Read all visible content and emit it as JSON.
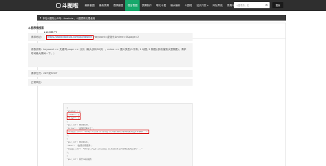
{
  "header": {
    "logo_text": "斗图啦",
    "nav": [
      {
        "label": "最新套图",
        "active": false
      },
      {
        "label": "最新表情",
        "active": false
      },
      {
        "label": "表情套图",
        "active": false
      },
      {
        "label": "恒言表图",
        "active": true
      },
      {
        "label": "表情制作",
        "active": false
      },
      {
        "label": "聊天斗图",
        "active": false
      },
      {
        "label": "输水偏码",
        "active": false
      },
      {
        "label": "斗图啦",
        "active": false
      },
      {
        "label": "站长开发 ▾",
        "active": false
      },
      {
        "label": "网站导航",
        "active": false
      },
      {
        "label": "表情斗图",
        "active": false
      }
    ],
    "search_placeholder": "斗图表情，在",
    "search_button": "搜索"
  },
  "breadcrumb": "本站斗图啦公众号：ibnshuls ，斗图表情无限使用",
  "card": {
    "title": "API接口",
    "section_title": "斗图表情搜索",
    "request_label": "请求地址：",
    "request_url": "https://www.doutula.com/api/search",
    "request_url_rest": "?keyword=金馆长&mime=0&page=2",
    "params": "参数说明：keyword => 关键词 page => 分页（最大页码50页），mime => 图片类型(0 所有, 1 动图, 2 静图)(其他值默认是静图)；请求时间最大隔间一下。)",
    "method": "请求方式：GET或POST",
    "response_label": "正常响应："
  },
  "code_lines": [
    "{",
    "    \"status\": 1,",
    "    \"data\": {",
    "        \"list\": [",
    "            {",
    "                \"pic_id\": 8834923,",
    "                \"title\": \"金馆长笑么了\",",
    "                \"image_url\": \"http://ww2.sinaimg.cn/bmiddle/9150e4e5gy1frW3H...\"",
    "            },",
    "            {",
    "                \"pic_id\": 8834921,",
    "                \"desc\": \"金馆长笑起来\",",
    "                \"image_url\": \"http://ww2.sinaimg.cn/bmiddle/9150e4e5gy1fr...\"",
    "            },",
    "            {",
    "                \"pic_id\": 有什么好说的"
  ],
  "colors": {
    "topbar": "#2f2f2f",
    "active_nav": "#17a86b",
    "highlight_border": "#d80000",
    "link": "#1a4ea8"
  }
}
